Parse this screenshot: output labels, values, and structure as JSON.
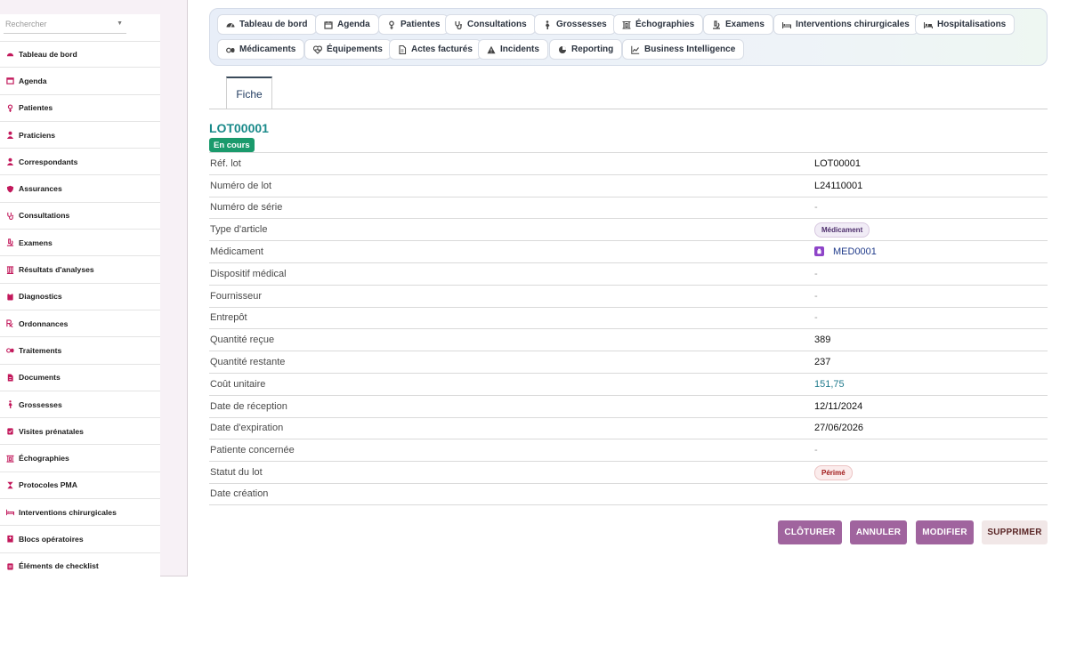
{
  "sidebar": {
    "search_placeholder": "Rechercher",
    "items": [
      {
        "label": "Tableau de bord",
        "icon": "dashboard-icon"
      },
      {
        "label": "Agenda",
        "icon": "calendar-icon"
      },
      {
        "label": "Patientes",
        "icon": "female-icon"
      },
      {
        "label": "Praticiens",
        "icon": "user-doctor-icon"
      },
      {
        "label": "Correspondants",
        "icon": "user-icon"
      },
      {
        "label": "Assurances",
        "icon": "shield-icon"
      },
      {
        "label": "Consultations",
        "icon": "stethoscope-icon"
      },
      {
        "label": "Examens",
        "icon": "microscope-icon"
      },
      {
        "label": "Résultats d'analyses",
        "icon": "vials-icon"
      },
      {
        "label": "Diagnostics",
        "icon": "clipboard-icon"
      },
      {
        "label": "Ordonnances",
        "icon": "prescription-icon"
      },
      {
        "label": "Traitements",
        "icon": "pills-icon"
      },
      {
        "label": "Documents",
        "icon": "file-icon"
      },
      {
        "label": "Grossesses",
        "icon": "pregnant-icon"
      },
      {
        "label": "Visites prénatales",
        "icon": "clipboard-check-icon"
      },
      {
        "label": "Échographies",
        "icon": "ultrasound-icon"
      },
      {
        "label": "Protocoles PMA",
        "icon": "hourglass-icon"
      },
      {
        "label": "Interventions chirurgicales",
        "icon": "bed-icon"
      },
      {
        "label": "Blocs opératoires",
        "icon": "hospital-icon"
      },
      {
        "label": "Éléments de checklist",
        "icon": "checklist-icon"
      }
    ]
  },
  "modules": [
    {
      "label": "Tableau de bord",
      "icon": "dashboard-icon"
    },
    {
      "label": "Agenda",
      "icon": "calendar-icon"
    },
    {
      "label": "Patientes",
      "icon": "female-icon"
    },
    {
      "label": "Consultations",
      "icon": "stethoscope-icon"
    },
    {
      "label": "Grossesses",
      "icon": "pregnant-icon"
    },
    {
      "label": "Échographies",
      "icon": "ultrasound-icon"
    },
    {
      "label": "Examens",
      "icon": "microscope-icon"
    },
    {
      "label": "Interventions chirurgicales",
      "icon": "bed-icon"
    },
    {
      "label": "Hospitalisations",
      "icon": "hospital-bed-icon"
    },
    {
      "label": "Médicaments",
      "icon": "pills-icon"
    },
    {
      "label": "Équipements",
      "icon": "heart-pulse-icon"
    },
    {
      "label": "Actes facturés",
      "icon": "invoice-icon"
    },
    {
      "label": "Incidents",
      "icon": "warning-icon"
    },
    {
      "label": "Reporting",
      "icon": "pie-chart-icon"
    },
    {
      "label": "Business Intelligence",
      "icon": "line-chart-icon"
    }
  ],
  "tabs": {
    "fiche": "Fiche"
  },
  "record": {
    "title": "LOT00001",
    "status": "En cours",
    "fields": {
      "ref_lot": {
        "label": "Réf. lot",
        "value": "LOT00001"
      },
      "numero_lot": {
        "label": "Numéro de lot",
        "value": "L24110001"
      },
      "numero_serie": {
        "label": "Numéro de série",
        "value": "-"
      },
      "type_article": {
        "label": "Type d'article",
        "value": "Médicament"
      },
      "medicament": {
        "label": "Médicament",
        "value": "MED0001"
      },
      "dispositif": {
        "label": "Dispositif médical",
        "value": "-"
      },
      "fournisseur": {
        "label": "Fournisseur",
        "value": "-"
      },
      "entrepot": {
        "label": "Entrepôt",
        "value": "-"
      },
      "qte_recue": {
        "label": "Quantité reçue",
        "value": "389"
      },
      "qte_restante": {
        "label": "Quantité restante",
        "value": "237"
      },
      "cout_unitaire": {
        "label": "Coût unitaire",
        "value": "151,75"
      },
      "date_reception": {
        "label": "Date de réception",
        "value": "12/11/2024"
      },
      "date_expiration": {
        "label": "Date d'expiration",
        "value": "27/06/2026"
      },
      "patiente": {
        "label": "Patiente concernée",
        "value": "-"
      },
      "statut_lot": {
        "label": "Statut du lot",
        "value": "Périmé"
      },
      "date_creation": {
        "label": "Date création",
        "value": ""
      }
    }
  },
  "actions": {
    "cloturer": "CLÔTURER",
    "annuler": "ANNULER",
    "modifier": "MODIFIER",
    "supprimer": "SUPPRIMER"
  },
  "colors": {
    "accent": "#a0649e",
    "title_teal": "#1a8a8a",
    "status_green": "#1a9a6c",
    "sidebar_icon": "#c2185b"
  }
}
